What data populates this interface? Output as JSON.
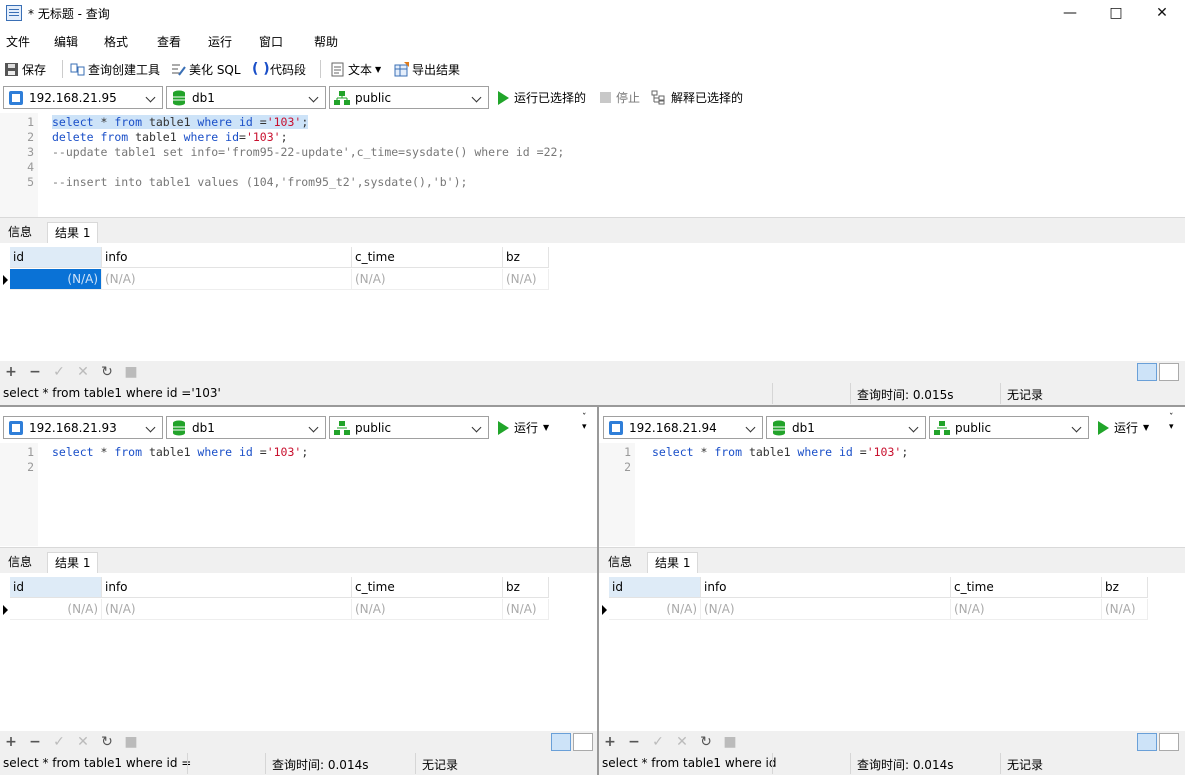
{
  "window": {
    "title": "* 无标题 - 查询"
  },
  "menu": [
    "文件",
    "编辑",
    "格式",
    "查看",
    "运行",
    "窗口",
    "帮助"
  ],
  "toolbar": {
    "save": "保存",
    "query_builder": "查询创建工具",
    "beautify": "美化 SQL",
    "snippet": "代码段",
    "text": "文本",
    "export": "导出结果"
  },
  "top_conn": {
    "host": "192.168.21.95",
    "db": "db1",
    "schema": "public",
    "run_selected": "运行已选择的",
    "stop": "停止",
    "explain_selected": "解释已选择的"
  },
  "editor_top": {
    "lines": [
      "1",
      "2",
      "3",
      "4",
      "5"
    ]
  },
  "result_tabs": {
    "info": "信息",
    "result1": "结果 1"
  },
  "columns": [
    "id",
    "info",
    "c_time",
    "bz"
  ],
  "null_value": "(N/A)",
  "top_status": {
    "sql": "select * from table1 where id ='103'",
    "time": "查询时间: 0.015s",
    "records": "无记录"
  },
  "left_conn": {
    "host": "192.168.21.93",
    "db": "db1",
    "schema": "public",
    "run": "运行"
  },
  "right_conn": {
    "host": "192.168.21.94",
    "db": "db1",
    "schema": "public",
    "run": "运行"
  },
  "sub_editor": {
    "lines": [
      "1",
      "2"
    ]
  },
  "left_status": {
    "sql": "select * from table1 where id =",
    "time": "查询时间: 0.014s",
    "records": "无记录"
  },
  "right_status": {
    "sql": "select * from table1 where id",
    "time": "查询时间: 0.014s",
    "records": "无记录"
  },
  "colors": {
    "accent": "#0a72d6",
    "selection": "#cde3f8",
    "keyword": "#1a4fc8",
    "string": "#c8102e",
    "run_green": "#21a52a"
  }
}
